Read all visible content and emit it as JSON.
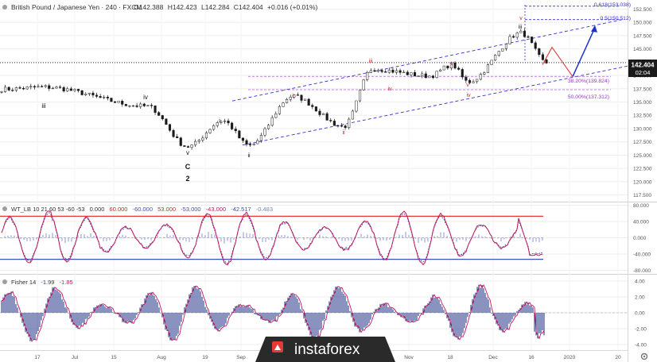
{
  "header": {
    "symbol": "British Pound / Japanese Yen",
    "interval": "240",
    "broker": "FXCM",
    "open": "O142.388",
    "high": "H142.423",
    "low": "L142.284",
    "close": "C142.404",
    "change": "+0.016 (+0.01%)"
  },
  "price_tag": {
    "value": "142.404",
    "countdown": "02:04"
  },
  "watermark": "instaforex",
  "colors": {
    "candle": "#1a1a1a",
    "channel": "#3333cc",
    "fib": "#9933cc",
    "projection_red": "#e53935",
    "projection_blue": "#1a33cc",
    "wave_red": "#cc2222",
    "wt1": "#c2185b",
    "wt2": "#3f51b5",
    "wt_hist": "#9fa8da",
    "ob": "#e53935",
    "os": "#3f51b5",
    "fisher_line": "#c2185b",
    "fisher_hist": "#2b3a8c",
    "watermark_bg": "#2a2a2a",
    "watermark_red": "#e53935",
    "panel_grid": "#eeeeee",
    "axis_text": "#555555"
  },
  "wave_labels": [
    {
      "text": "iii",
      "color": "black"
    },
    {
      "text": "iv",
      "color": "black"
    },
    {
      "text": "v",
      "color": "black"
    },
    {
      "text": "C",
      "color": "black"
    },
    {
      "text": "2",
      "color": "black"
    },
    {
      "text": "i",
      "color": "black"
    },
    {
      "text": "ii",
      "color": "black"
    },
    {
      "text": "i",
      "color": "red"
    },
    {
      "text": "ii",
      "color": "red"
    },
    {
      "text": "iii",
      "color": "red"
    },
    {
      "text": "iv",
      "color": "red"
    },
    {
      "text": "v",
      "color": "red"
    },
    {
      "text": "v",
      "color": "red"
    },
    {
      "text": "iv",
      "color": "red"
    },
    {
      "text": "v",
      "color": "red"
    },
    {
      "text": "iii",
      "color": "black"
    },
    {
      "text": "v",
      "color": "red"
    }
  ],
  "fib_labels": {
    "f618": "0.618(153.038)",
    "f50": "0.5(150.512)",
    "f382": "38.20%(139.824)",
    "f500": "50.00%(137.312)"
  },
  "wt_header": {
    "name": "WT_LB 10 21 60 53 -60 -53",
    "v1": "0.000",
    "v2": "60.000",
    "v3": "-60.000",
    "v4": "53.000",
    "v5": "-53.000",
    "v6": "-43.000",
    "v7": "-42.517",
    "v8": "-0.483"
  },
  "fisher_header": {
    "name": "Fisher 14",
    "v1": "-1.99",
    "v2": "-1.85"
  },
  "chart_data": [
    {
      "type": "candlestick",
      "title": "British Pound / Japanese Yen · 240 · FXCM",
      "y_ticks": [
        "152.500",
        "150.000",
        "147.500",
        "145.000",
        "142.500",
        "140.000",
        "137.500",
        "135.000",
        "132.500",
        "130.000",
        "127.500",
        "125.000",
        "122.500",
        "120.000",
        "117.500"
      ],
      "ylim": [
        116.4,
        154.2
      ],
      "x_ticks": [
        "17",
        "Jul",
        "15",
        "Aug",
        "19",
        "Sep",
        "Nov",
        "18",
        "Dec",
        "16",
        "2020",
        "20"
      ],
      "last_price": 142.404,
      "key_points": [
        {
          "label": "start",
          "value": 137.4
        },
        {
          "label": "iii",
          "value": 137.8
        },
        {
          "label": "iv",
          "value": 134.2
        },
        {
          "label": "C / 2",
          "value": 126.6
        },
        {
          "label": "i",
          "value": 131.5
        },
        {
          "label": "ii",
          "value": 126.8
        },
        {
          "label": "i (red)",
          "value": 136.1
        },
        {
          "label": "ii (red)",
          "value": 130.4
        },
        {
          "label": "iii (red)",
          "value": 141.2
        },
        {
          "label": "iv (red)",
          "value": 139.9
        },
        {
          "label": "v (red)",
          "value": 142.0
        },
        {
          "label": "iv (red)",
          "value": 138.8
        },
        {
          "label": "iii",
          "value": 148.0
        },
        {
          "label": "last",
          "value": 142.4
        }
      ],
      "levels": [
        {
          "name": "0.618",
          "value": 153.038
        },
        {
          "name": "0.5",
          "value": 150.512
        },
        {
          "name": "38.20%",
          "value": 139.824
        },
        {
          "name": "50.00%",
          "value": 137.312
        }
      ],
      "projection": [
        142.0,
        145.3,
        139.8,
        149.0
      ]
    },
    {
      "type": "line",
      "title": "WT_LB 10 21 60 53 -60 -53",
      "y_ticks": [
        "80.000",
        "40.000",
        "0.000",
        "-40.000",
        "-80.000"
      ],
      "ylim": [
        -85,
        85
      ],
      "levels": [
        53,
        -53
      ],
      "last_values": [
        -43.0,
        -42.517
      ]
    },
    {
      "type": "bar",
      "title": "Fisher 14",
      "y_ticks": [
        "4.00",
        "2.00",
        "0.00",
        "-2.00",
        "-4.00"
      ],
      "ylim": [
        -4.6,
        4.6
      ],
      "last_values": [
        -1.99,
        -1.85
      ]
    }
  ]
}
